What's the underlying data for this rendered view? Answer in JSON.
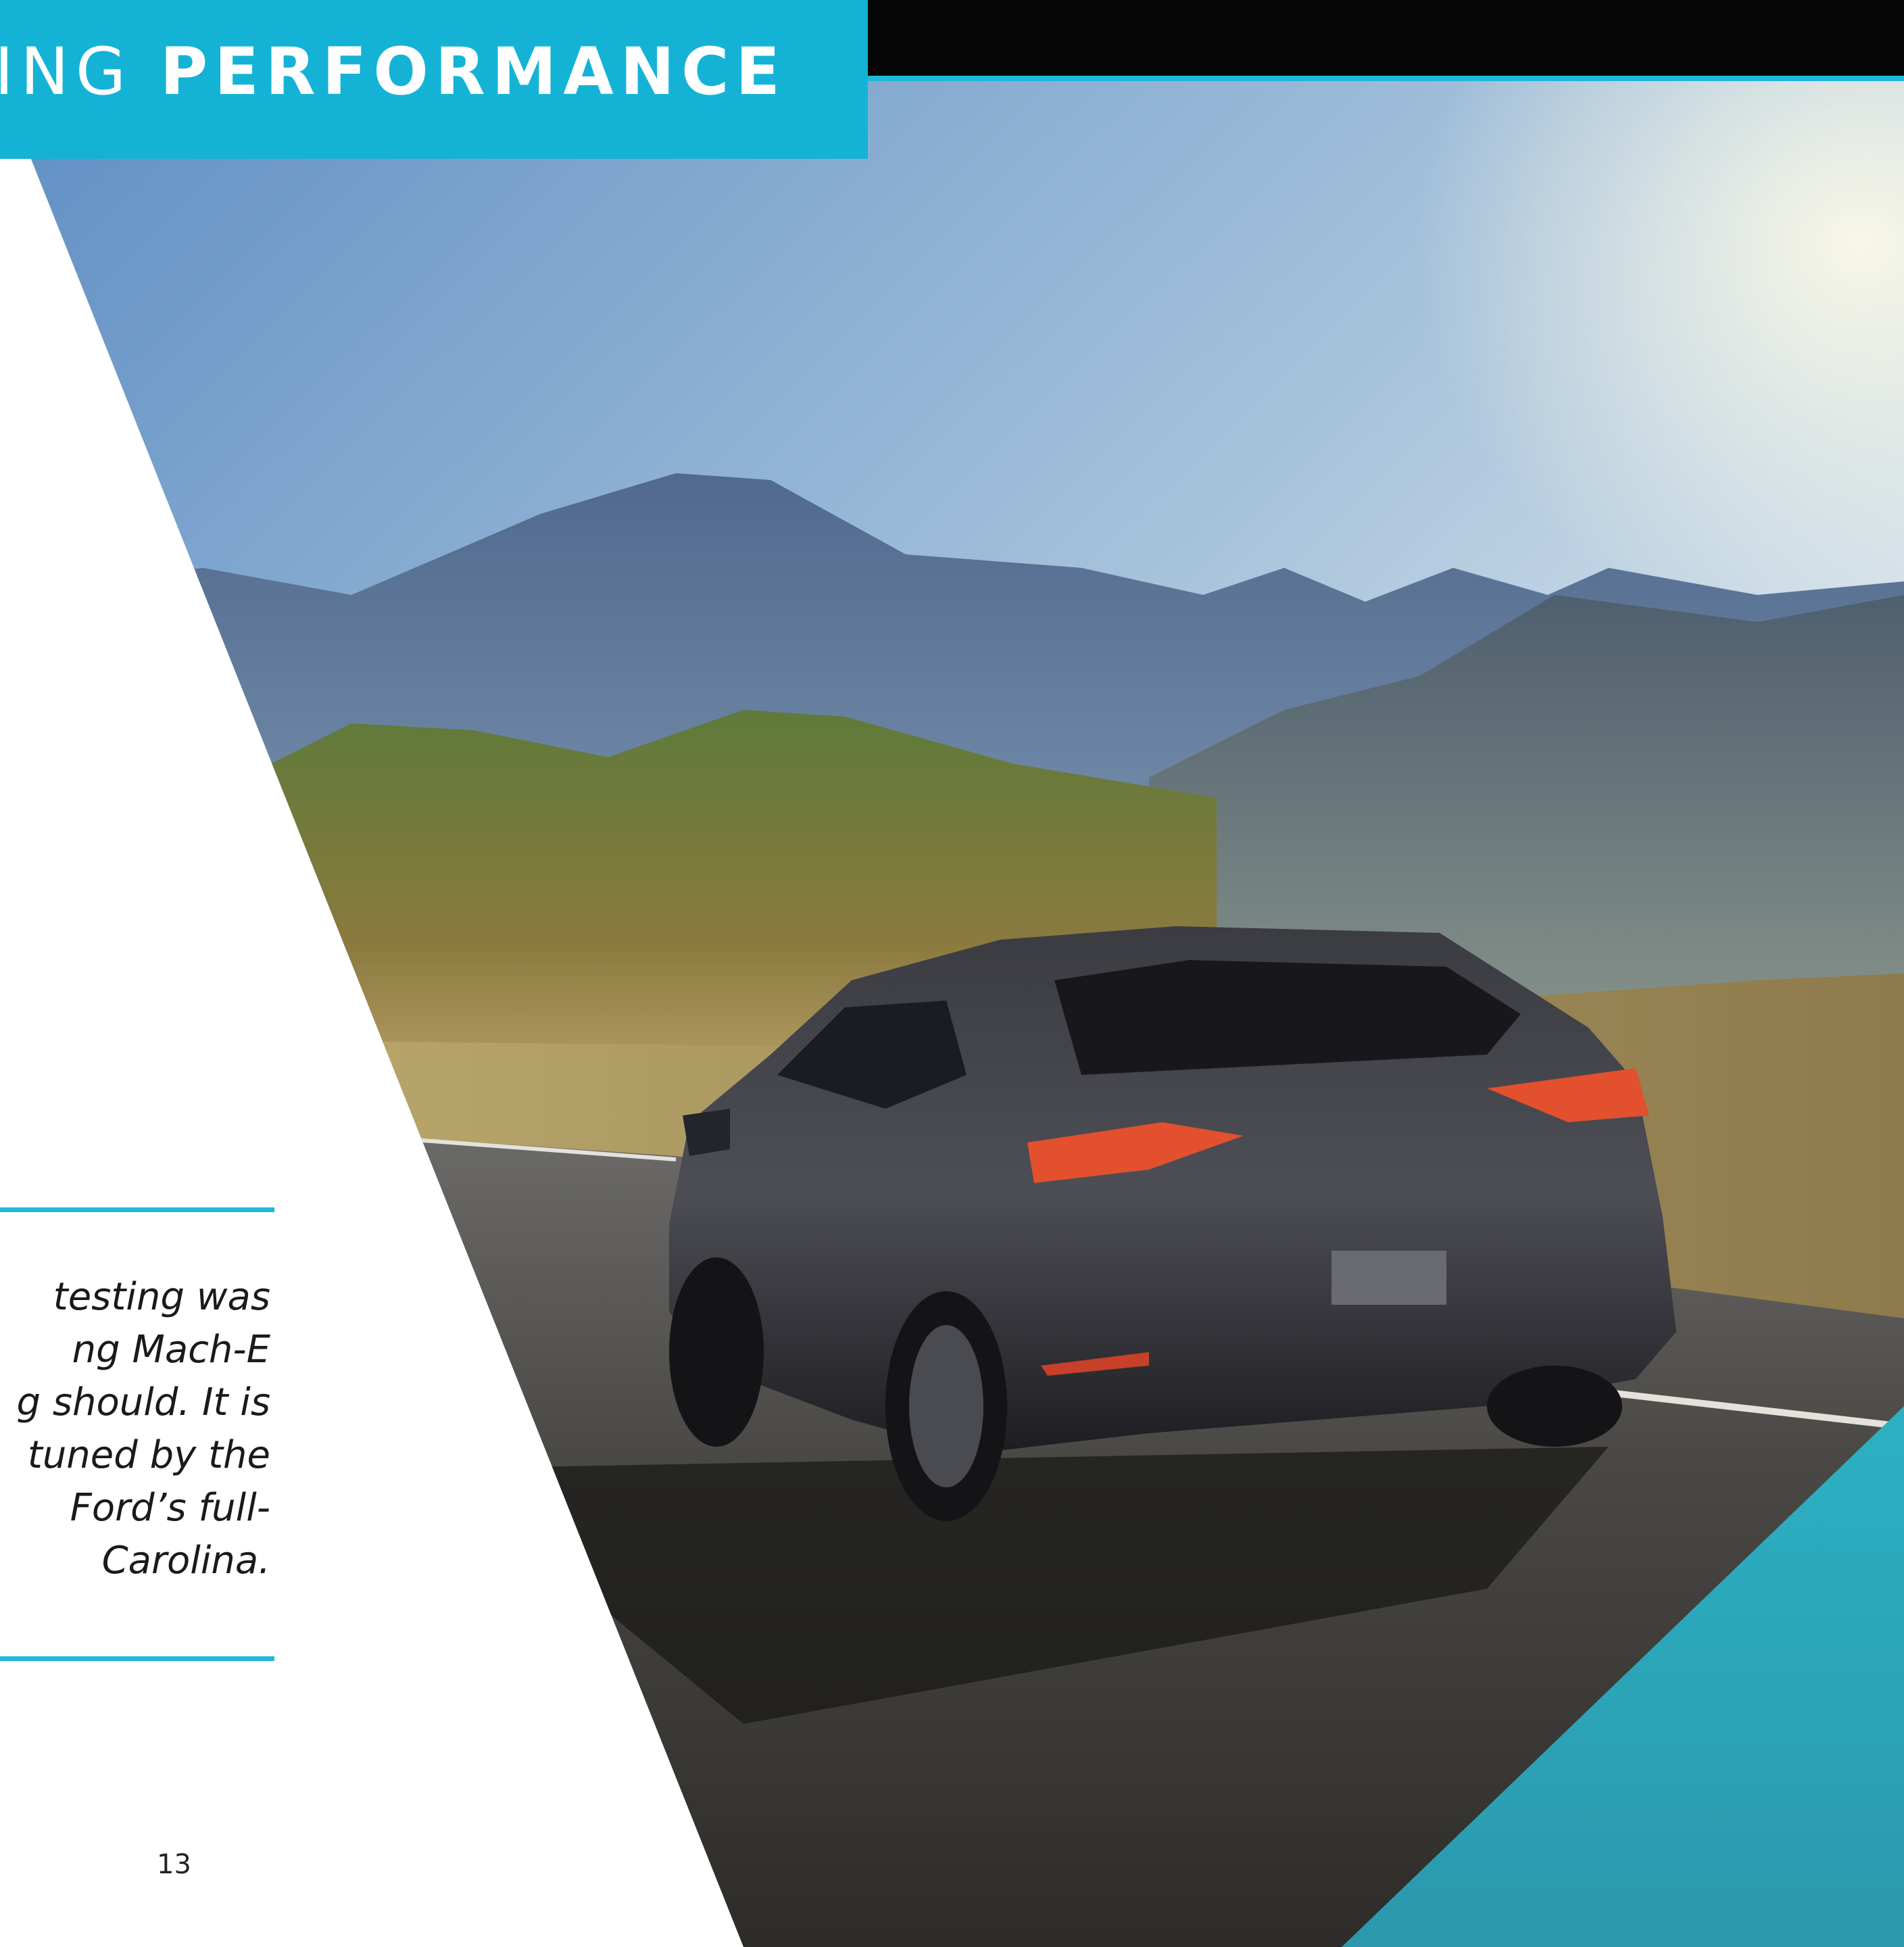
{
  "header": {
    "title_light": "KING",
    "title_bold": "PERFORMANCE"
  },
  "quote": {
    "lines": [
      "testing was",
      "ng Mach-E",
      "g should. It is",
      "tuned by the",
      "Ford’s full-",
      "Carolina."
    ]
  },
  "footer": {
    "page_number": "13"
  },
  "colors": {
    "accent_cyan": "#1fb8d8",
    "header_black": "#050505",
    "corner_teal": "#2aa9bc"
  }
}
